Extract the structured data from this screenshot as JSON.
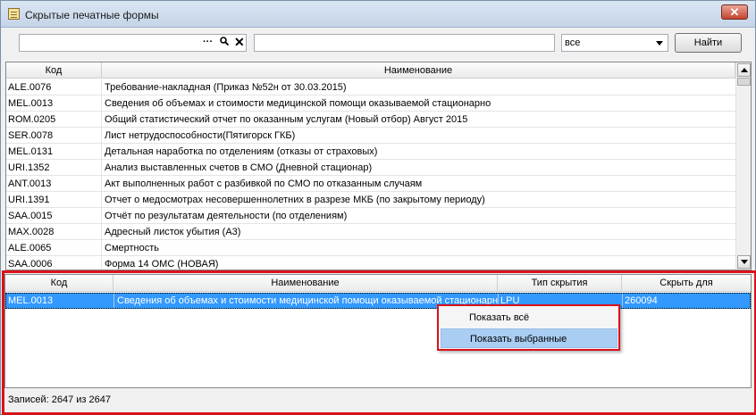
{
  "window": {
    "title": "Скрытые печатные формы",
    "close": "✕"
  },
  "toolbar": {
    "search_value": "",
    "dots": "···",
    "clear": "✕",
    "text_value": "",
    "filter_selected": "все",
    "find_label": "Найти"
  },
  "main_grid": {
    "headers": {
      "code": "Код",
      "name": "Наименование"
    },
    "rows": [
      {
        "code": "ALE.0076",
        "name": "Требование-накладная (Приказ №52н от 30.03.2015)"
      },
      {
        "code": "MEL.0013",
        "name": "Сведения об объемах и стоимости  медицинской помощи оказываемой стационарно"
      },
      {
        "code": "ROM.0205",
        "name": "Общий статистический отчет по оказанным услугам (Новый отбор) Август 2015"
      },
      {
        "code": "SER.0078",
        "name": "Лист нетрудоспособности(Пятигорск ГКБ)"
      },
      {
        "code": "MEL.0131",
        "name": "Детальная наработка по отделениям (отказы от страховых)"
      },
      {
        "code": "URI.1352",
        "name": "Анализ выставленных счетов в СМО (Дневной стационар)"
      },
      {
        "code": "ANT.0013",
        "name": "Акт выполненных работ с разбивкой по СМО по отказанным случаям"
      },
      {
        "code": "URI.1391",
        "name": "Отчет о медосмотрах несовершеннолетних в разрезе МКБ (по закрытому периоду)"
      },
      {
        "code": "SAA.0015",
        "name": "Отчёт по результатам деятельности (по отделениям)"
      },
      {
        "code": "MAX.0028",
        "name": "Адресный листок убытия (А3)"
      },
      {
        "code": "ALE.0065",
        "name": "Смертность"
      },
      {
        "code": "SAA.0006",
        "name": "Форма 14 ОМС (НОВАЯ)"
      }
    ]
  },
  "hidden_grid": {
    "headers": {
      "code": "Код",
      "name": "Наименование",
      "hide_type": "Тип скрытия",
      "hide_for": "Скрыть для"
    },
    "row": {
      "code": "MEL.0013",
      "name": "Сведения об объемах и стоимости  медицинской помощи оказываемой стационарно",
      "hide_type": "LPU",
      "hide_for": "260094"
    }
  },
  "context_menu": {
    "show_all": "Показать всё",
    "show_selected": "Показать выбранные"
  },
  "status": {
    "records": "Записей: 2647 из 2647"
  },
  "colors": {
    "selection": "#3399ff",
    "highlight_frame": "#d9121b",
    "menu_hover": "#a9cdf3"
  }
}
